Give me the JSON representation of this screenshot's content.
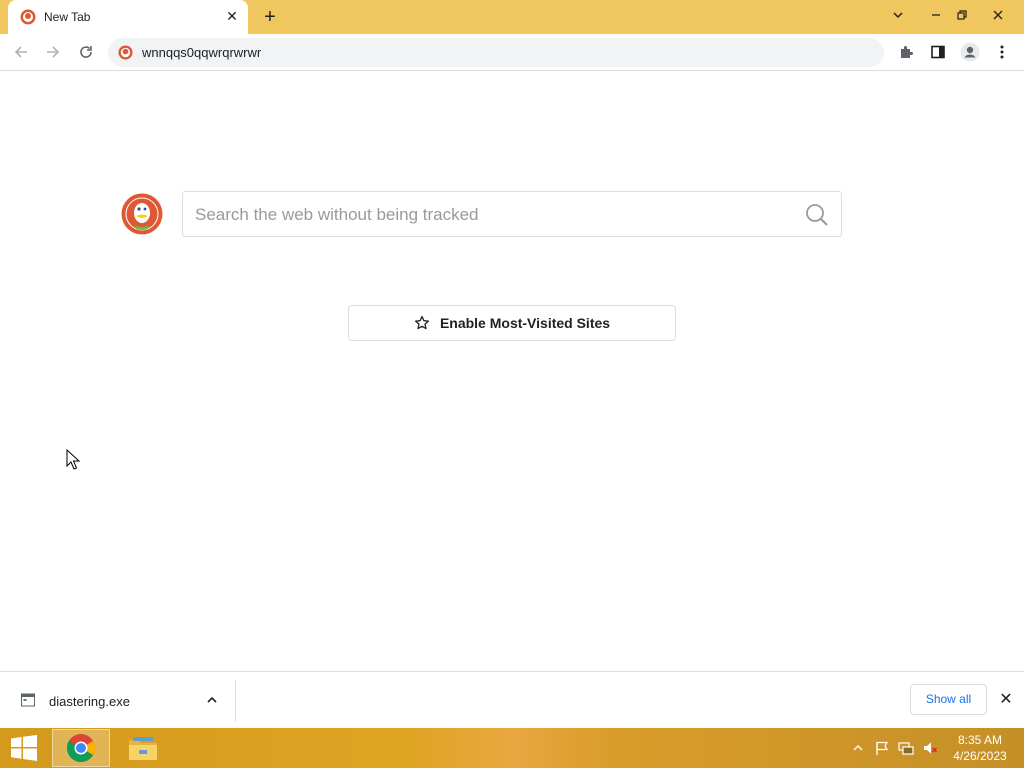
{
  "browser": {
    "tab": {
      "title": "New Tab",
      "favicon": "duckduckgo-icon"
    },
    "window_controls": [
      "chevron-down-icon",
      "minimize-icon",
      "restore-icon",
      "close-icon"
    ],
    "address_bar": {
      "url": "wnnqqs0qqwrqrwrwr"
    },
    "toolbar_icons": [
      "back-icon",
      "forward-icon",
      "reload-icon",
      "extensions-icon",
      "side-panel-icon",
      "profile-icon",
      "menu-icon"
    ]
  },
  "page": {
    "search": {
      "placeholder": "Search the web without being tracked"
    },
    "enable_button": {
      "label": "Enable Most-Visited Sites"
    }
  },
  "download_bar": {
    "file_name": "diastering.exe",
    "show_all_label": "Show all"
  },
  "taskbar": {
    "apps": [
      "windows-start-icon",
      "chrome-icon",
      "file-explorer-icon"
    ],
    "tray_icons": [
      "tray-chevron-icon",
      "action-center-flag-icon",
      "network-icon",
      "volume-muted-icon"
    ],
    "time": "8:35 AM",
    "date": "4/26/2023"
  },
  "colors": {
    "tabstrip": "#f0c75e",
    "taskbar": "#e0a423",
    "ddg_orange": "#de5833",
    "link_blue": "#1a73e8"
  }
}
